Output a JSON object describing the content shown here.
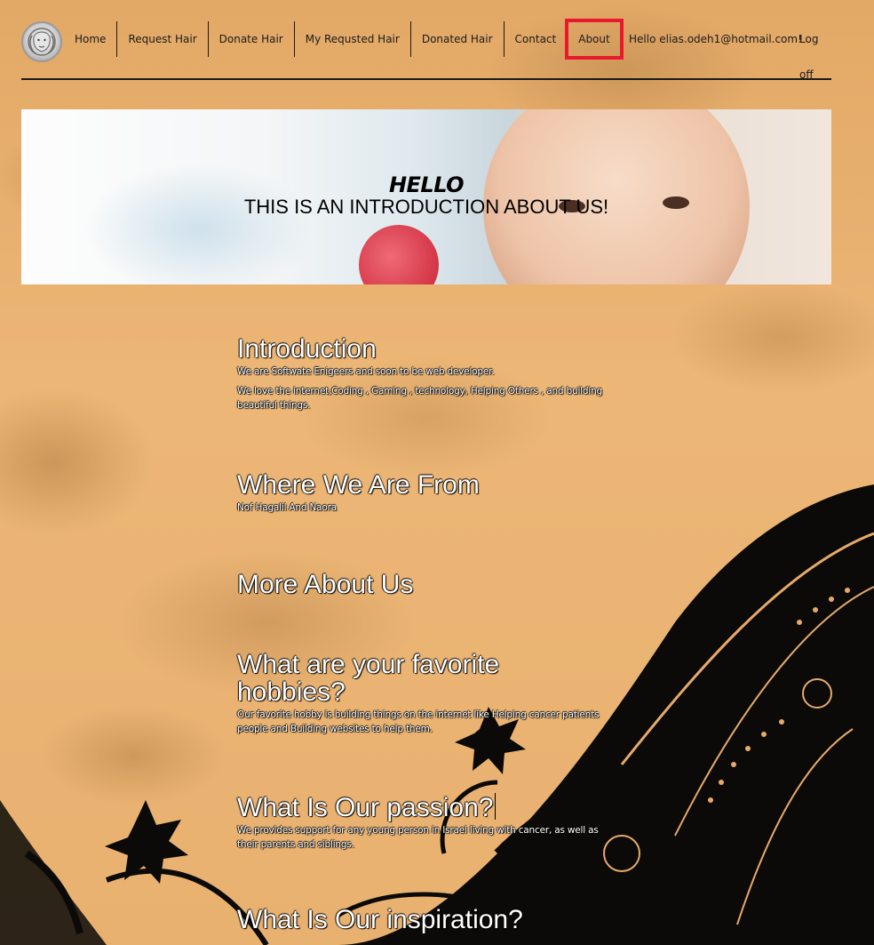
{
  "nav": {
    "logo": "logo-icon",
    "items": [
      {
        "label": "Home"
      },
      {
        "label": "Request Hair"
      },
      {
        "label": "Donate Hair"
      },
      {
        "label": "My Requsted Hair"
      },
      {
        "label": "Donated Hair"
      },
      {
        "label": "Contact"
      },
      {
        "label": "About",
        "active": true
      }
    ],
    "greeting": "Hello elias.odeh1@hotmail.com!",
    "logoff": "Log off",
    "active_highlight_color": "#e8192c"
  },
  "hero": {
    "title": "HELLO",
    "subtitle": "THIS IS AN INTRODUCTION ABOUT US!"
  },
  "sections": {
    "intro": {
      "heading": "Introduction",
      "paragraphs": [
        "We are Softwate Enigeers and soon to be web developer.",
        "We love the internet,Coding , Gaming , technology, Helping Others , and building beautiful things."
      ]
    },
    "from": {
      "heading": "Where We Are From",
      "paragraphs": [
        "Nof Hagalil And Naora"
      ]
    },
    "more": {
      "heading": "More About Us"
    },
    "hobbies": {
      "heading": "What are your favorite hobbies?",
      "paragraphs": [
        "Our favorite hobby is building things on the internet like Helping cancer patients people and Building websites to help them."
      ]
    },
    "passion": {
      "heading": "What Is Our passion?",
      "paragraphs": [
        "We provides support for any young person in Israel living with cancer, as well as their parents and siblings."
      ]
    },
    "inspiration": {
      "heading": "What Is Our inspiration?"
    }
  },
  "colors": {
    "background": "#e8b06c",
    "text": "#ffffff",
    "nav_text": "#1b1b1b"
  }
}
